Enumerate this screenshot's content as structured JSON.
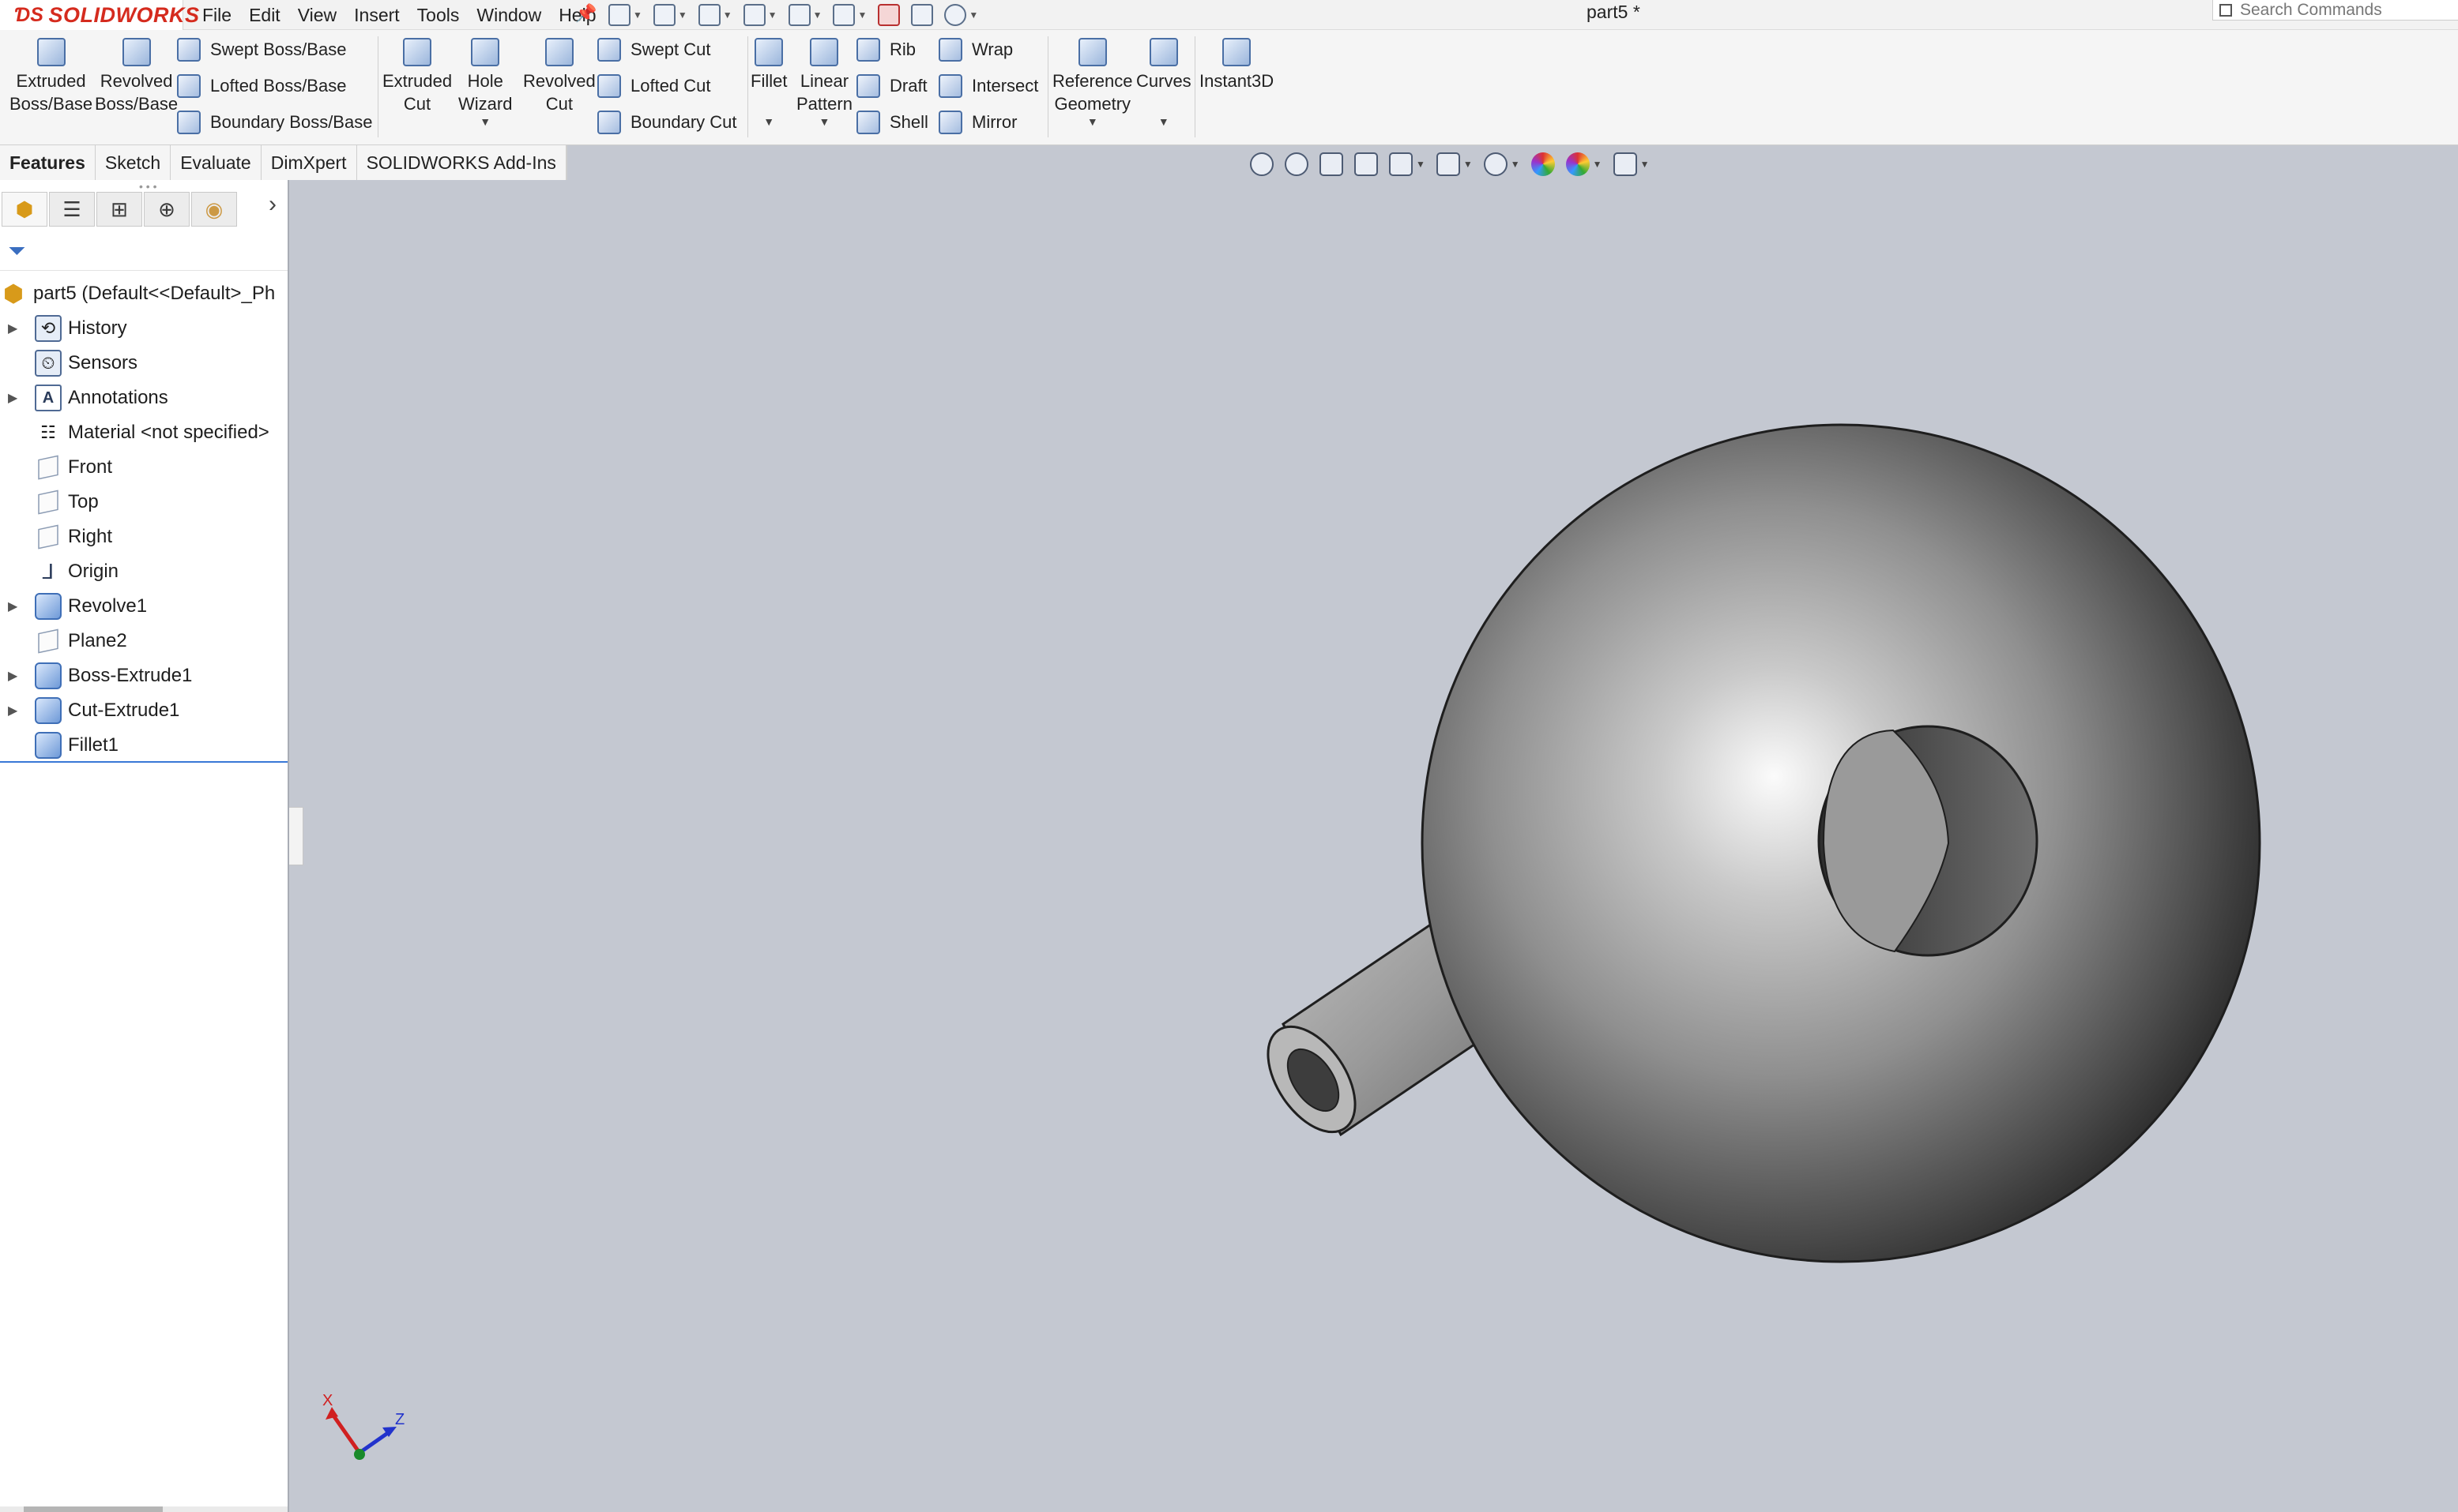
{
  "app": {
    "brand": "SOLIDWORKS",
    "menus": [
      "File",
      "Edit",
      "View",
      "Insert",
      "Tools",
      "Window",
      "Help"
    ],
    "document_title": "part5 *",
    "search_placeholder": "Search Commands"
  },
  "command_manager": {
    "extruded_boss": [
      "Extruded",
      "Boss/Base"
    ],
    "revolved_boss": [
      "Revolved",
      "Boss/Base"
    ],
    "swept_boss": "Swept Boss/Base",
    "lofted_boss": "Lofted Boss/Base",
    "boundary_boss": "Boundary Boss/Base",
    "extruded_cut": [
      "Extruded",
      "Cut"
    ],
    "hole_wizard": [
      "Hole",
      "Wizard"
    ],
    "revolved_cut": [
      "Revolved",
      "Cut"
    ],
    "swept_cut": "Swept Cut",
    "lofted_cut": "Lofted Cut",
    "boundary_cut": "Boundary Cut",
    "fillet": "Fillet",
    "linear_pattern": [
      "Linear",
      "Pattern"
    ],
    "rib": "Rib",
    "draft": "Draft",
    "shell": "Shell",
    "wrap": "Wrap",
    "intersect": "Intersect",
    "mirror": "Mirror",
    "reference_geometry": [
      "Reference",
      "Geometry"
    ],
    "curves": "Curves",
    "instant3d": "Instant3D"
  },
  "tabs": [
    "Features",
    "Sketch",
    "Evaluate",
    "DimXpert",
    "SOLIDWORKS Add-Ins"
  ],
  "active_tab": "Features",
  "feature_tree": {
    "root": "part5  (Default<<Default>_Ph",
    "items": [
      {
        "label": "History",
        "expandable": true,
        "icon": "history-folder-icon"
      },
      {
        "label": "Sensors",
        "expandable": false,
        "icon": "sensors-folder-icon"
      },
      {
        "label": "Annotations",
        "expandable": true,
        "icon": "annotations-icon"
      },
      {
        "label": "Material <not specified>",
        "expandable": false,
        "icon": "material-icon"
      },
      {
        "label": "Front",
        "expandable": false,
        "icon": "plane-icon"
      },
      {
        "label": "Top",
        "expandable": false,
        "icon": "plane-icon"
      },
      {
        "label": "Right",
        "expandable": false,
        "icon": "plane-icon"
      },
      {
        "label": "Origin",
        "expandable": false,
        "icon": "origin-icon"
      },
      {
        "label": "Revolve1",
        "expandable": true,
        "icon": "revolve-feature-icon"
      },
      {
        "label": "Plane2",
        "expandable": false,
        "icon": "plane-icon"
      },
      {
        "label": "Boss-Extrude1",
        "expandable": true,
        "icon": "boss-extrude-icon"
      },
      {
        "label": "Cut-Extrude1",
        "expandable": true,
        "icon": "cut-extrude-icon"
      },
      {
        "label": "Fillet1",
        "expandable": false,
        "icon": "fillet-icon"
      }
    ]
  },
  "triad": {
    "x": "X",
    "z": "Z"
  },
  "colors": {
    "viewport_bg": "#c4c8d1",
    "brand_red": "#d52b1e",
    "selection_blue": "#3978d6"
  }
}
